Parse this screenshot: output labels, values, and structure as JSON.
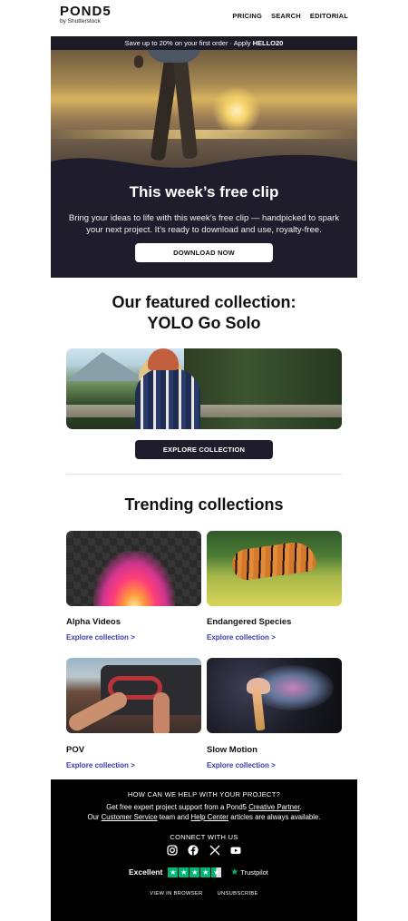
{
  "header": {
    "logo": "POND5",
    "logo_sub": "by Shutterstock",
    "nav": [
      "PRICING",
      "SEARCH",
      "EDITORIAL"
    ]
  },
  "promo": {
    "text": "Save up to 20% on your first order · Apply ",
    "code": "HELLO20"
  },
  "hero": {
    "title": "This week’s free clip",
    "body": "Bring your ideas to life with this week’s free clip — handpicked to spark your next project. It’s ready to download and use, royalty-free.",
    "button": "DOWNLOAD NOW"
  },
  "featured": {
    "line1": "Our featured collection:",
    "line2": "YOLO Go Solo",
    "button": "EXPLORE COLLECTION"
  },
  "trending": {
    "title": "Trending collections",
    "link_label": "Explore collection >",
    "items": [
      {
        "title": "Alpha Videos"
      },
      {
        "title": "Endangered Species"
      },
      {
        "title": "POV"
      },
      {
        "title": "Slow Motion"
      }
    ]
  },
  "footer": {
    "question": "HOW CAN WE HELP WITH YOUR PROJECT?",
    "line1_pre": "Get free expert project support from a Pond5 ",
    "line1_link": "Creative Partner",
    "line1_post": ".",
    "line2_pre": "Our ",
    "line2_link1": "Customer Service",
    "line2_mid": " team and ",
    "line2_link2": "Help Center",
    "line2_post": " articles are always available.",
    "connect": "CONNECT WITH US",
    "social_icons": [
      "instagram-icon",
      "facebook-icon",
      "x-icon",
      "youtube-icon"
    ],
    "rating_word": "Excellent",
    "rating_stars": 4.5,
    "trustpilot": "Trustpilot",
    "links": [
      "VIEW IN BROWSER",
      "UNSUBSCRIBE"
    ]
  },
  "colors": {
    "dark_panel": "#1f1c2b",
    "link": "#3b3aa8",
    "trustpilot_green": "#00b67a"
  }
}
